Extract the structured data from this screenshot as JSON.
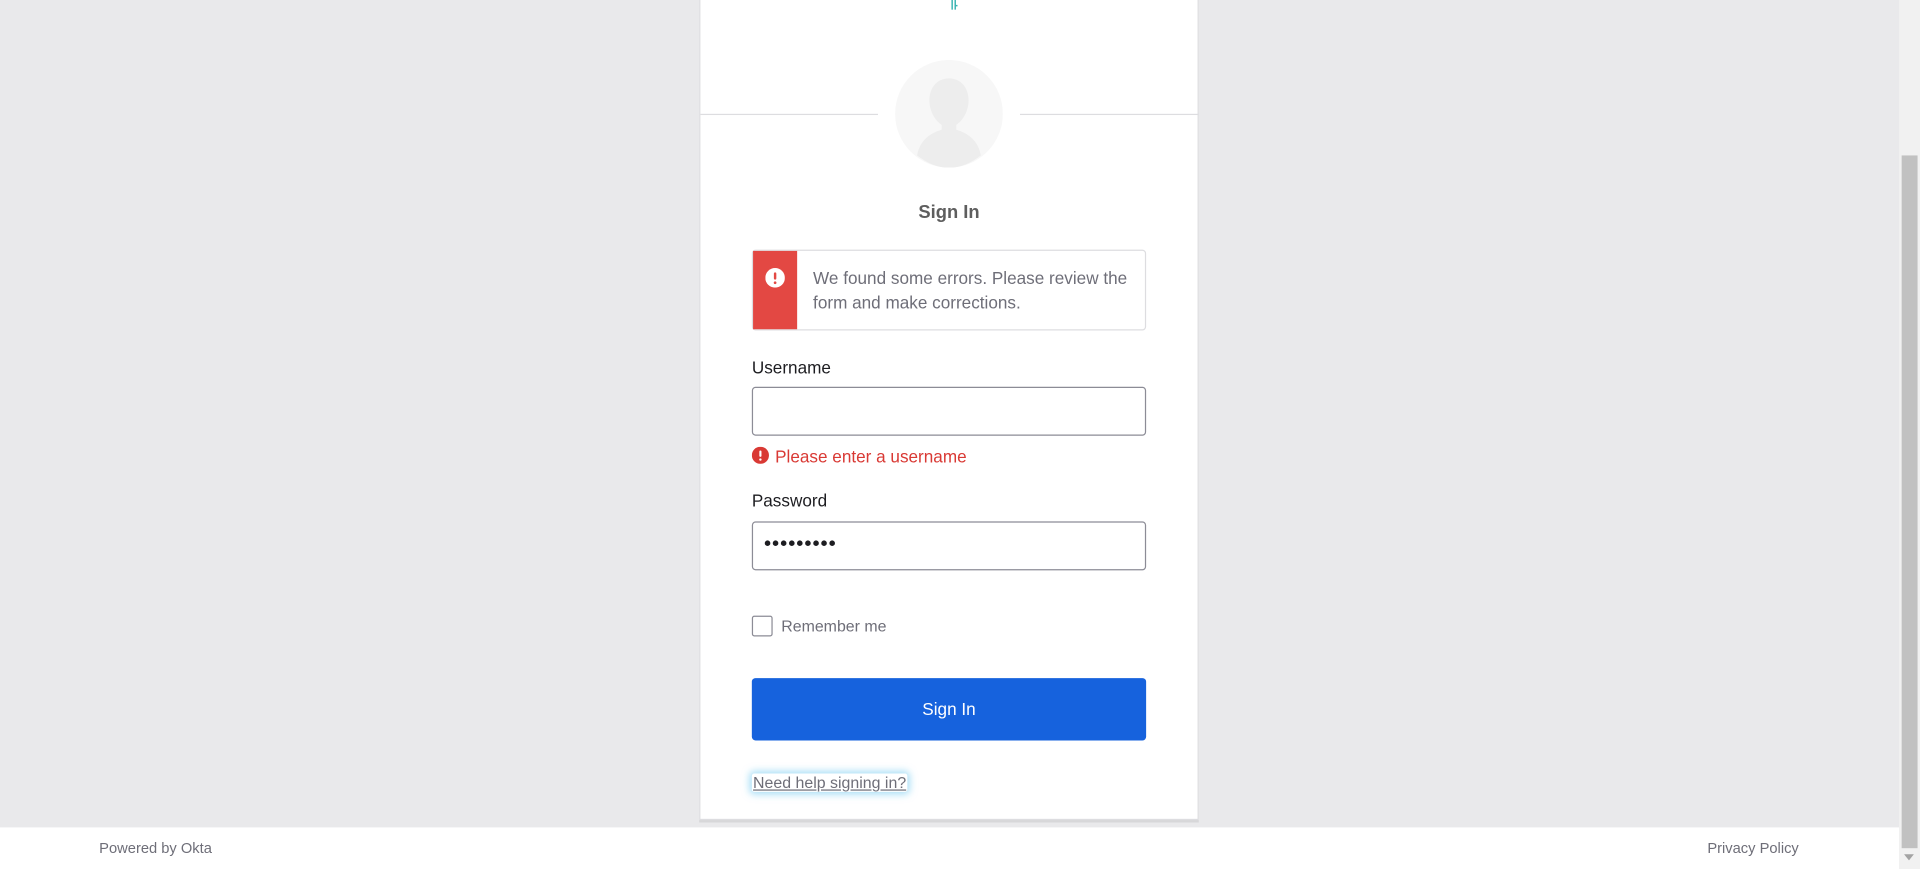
{
  "signin": {
    "title": "Sign In",
    "error_banner": "We found some errors. Please review the form and make corrections.",
    "username": {
      "label": "Username",
      "value": "",
      "error": "Please enter a username"
    },
    "password": {
      "label": "Password",
      "masked_value": "•••••••••"
    },
    "remember_me": {
      "label": "Remember me",
      "checked": false
    },
    "submit_label": "Sign In",
    "help_link": "Need help signing in?"
  },
  "footer": {
    "powered_by": "Powered by Okta",
    "privacy_link": "Privacy Policy"
  },
  "colors": {
    "primary_button": "#1662dd",
    "error": "#e34843",
    "page_background": "#e9e9eb"
  },
  "icons": {
    "avatar": "user-silhouette-icon",
    "error_banner": "exclamation-circle-icon",
    "field_error": "exclamation-circle-icon"
  }
}
